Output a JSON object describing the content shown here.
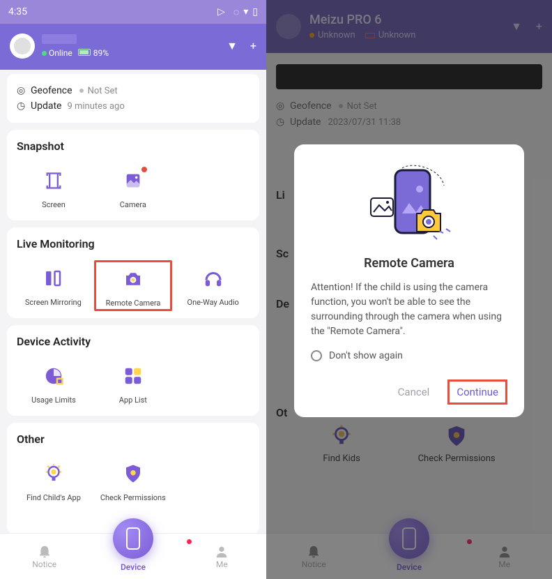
{
  "statusbar": {
    "time": "4:35"
  },
  "header": {
    "online": "Online",
    "battery": "89%"
  },
  "info": {
    "geofence_label": "Geofence",
    "geofence_value": "Not Set",
    "update_label": "Update",
    "update_value": "9 minutes ago"
  },
  "sections": {
    "snapshot": {
      "title": "Snapshot",
      "items": [
        {
          "label": "Screen"
        },
        {
          "label": "Camera"
        }
      ]
    },
    "live": {
      "title": "Live Monitoring",
      "items": [
        {
          "label": "Screen Mirroring"
        },
        {
          "label": "Remote Camera"
        },
        {
          "label": "One-Way Audio"
        }
      ]
    },
    "activity": {
      "title": "Device Activity",
      "items": [
        {
          "label": "Usage Limits"
        },
        {
          "label": "App List"
        }
      ]
    },
    "other": {
      "title": "Other",
      "items": [
        {
          "label": "Find Child's App"
        },
        {
          "label": "Check Permissions"
        }
      ]
    }
  },
  "nav": {
    "notice": "Notice",
    "device": "Device",
    "me": "Me"
  },
  "right": {
    "device_name": "Meizu PRO 6",
    "unknown": "Unknown",
    "geofence_label": "Geofence",
    "geofence_value": "Not Set",
    "update_label": "Update",
    "update_value": "2023/07/31 11:38",
    "sec_l": "Li",
    "sec_s": "Sc",
    "sec_d": "De",
    "sec_o": "Ot",
    "other_items": [
      {
        "label": "Find Kids"
      },
      {
        "label": "Check Permissions"
      }
    ]
  },
  "modal": {
    "title": "Remote Camera",
    "body": "Attention! If the child is using the camera function, you won't be able to see the surrounding through the camera when using the \"Remote Camera\".",
    "dont_show": "Don't show again",
    "cancel": "Cancel",
    "continue": "Continue"
  }
}
